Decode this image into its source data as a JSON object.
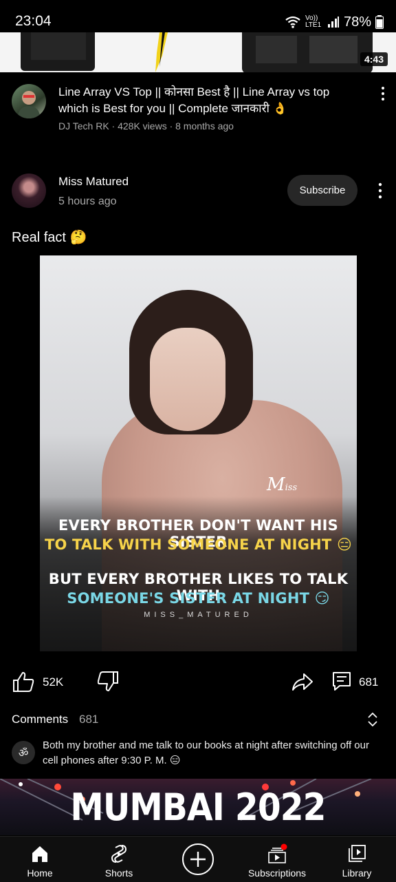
{
  "status_bar": {
    "time": "23:04",
    "network_label": "Vo)) LTE1",
    "battery": "78%"
  },
  "video": {
    "duration": "4:43",
    "title": "Line Array VS Top || कोनसा Best है || Line Array vs top which is Best for you || Complete जानकारी 👌",
    "channel": "DJ Tech RK",
    "views": "428K views",
    "age": "8 months ago",
    "meta": "DJ Tech RK · 428K views · 8 months ago"
  },
  "post": {
    "author": "Miss Matured",
    "time": "5 hours ago",
    "subscribe_label": "Subscribe",
    "text": "Real fact 🤔",
    "image": {
      "brand": "Miss Matured",
      "caption_line1": "EVERY BROTHER DON'T WANT HIS SISTER",
      "caption_line2": "TO TALK WITH SOMEONE AT NIGHT 😑",
      "caption_line3": "BUT EVERY BROTHER LIKES TO TALK WITH",
      "caption_line4": "SOMEONE'S SISTER AT NIGHT 😏",
      "watermark": "MISS_MATURED"
    },
    "likes": "52K",
    "comments": "681"
  },
  "comments_section": {
    "title": "Comments",
    "count": "681",
    "top_comment_avatar": "ॐ",
    "top_comment": "Both my brother and me talk to our books at night after switching off our cell phones after 9:30 P. M. 😑"
  },
  "banner": {
    "text": "MUMBAI 2022"
  },
  "nav": {
    "home": "Home",
    "shorts": "Shorts",
    "subscriptions": "Subscriptions",
    "library": "Library"
  },
  "icons": [
    "wifi-icon",
    "signal-icon",
    "battery-icon",
    "more-vert-icon",
    "like-icon",
    "dislike-icon",
    "share-icon",
    "comment-icon",
    "expand-icon",
    "home-icon",
    "shorts-icon",
    "create-icon",
    "subscriptions-icon",
    "library-icon"
  ]
}
